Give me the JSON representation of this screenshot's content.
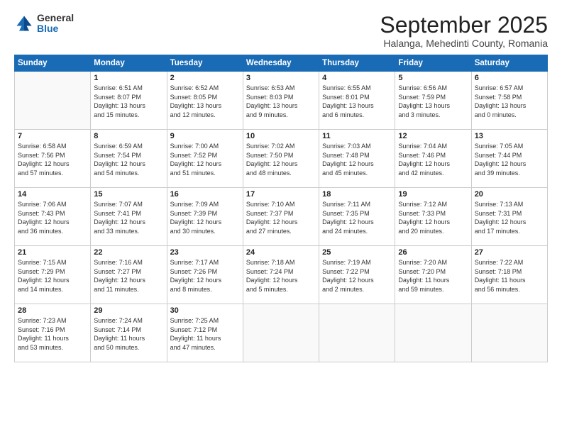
{
  "logo": {
    "general": "General",
    "blue": "Blue"
  },
  "title": "September 2025",
  "subtitle": "Halanga, Mehedinti County, Romania",
  "days_header": [
    "Sunday",
    "Monday",
    "Tuesday",
    "Wednesday",
    "Thursday",
    "Friday",
    "Saturday"
  ],
  "weeks": [
    [
      {
        "day": "",
        "info": ""
      },
      {
        "day": "1",
        "info": "Sunrise: 6:51 AM\nSunset: 8:07 PM\nDaylight: 13 hours\nand 15 minutes."
      },
      {
        "day": "2",
        "info": "Sunrise: 6:52 AM\nSunset: 8:05 PM\nDaylight: 13 hours\nand 12 minutes."
      },
      {
        "day": "3",
        "info": "Sunrise: 6:53 AM\nSunset: 8:03 PM\nDaylight: 13 hours\nand 9 minutes."
      },
      {
        "day": "4",
        "info": "Sunrise: 6:55 AM\nSunset: 8:01 PM\nDaylight: 13 hours\nand 6 minutes."
      },
      {
        "day": "5",
        "info": "Sunrise: 6:56 AM\nSunset: 7:59 PM\nDaylight: 13 hours\nand 3 minutes."
      },
      {
        "day": "6",
        "info": "Sunrise: 6:57 AM\nSunset: 7:58 PM\nDaylight: 13 hours\nand 0 minutes."
      }
    ],
    [
      {
        "day": "7",
        "info": "Sunrise: 6:58 AM\nSunset: 7:56 PM\nDaylight: 12 hours\nand 57 minutes."
      },
      {
        "day": "8",
        "info": "Sunrise: 6:59 AM\nSunset: 7:54 PM\nDaylight: 12 hours\nand 54 minutes."
      },
      {
        "day": "9",
        "info": "Sunrise: 7:00 AM\nSunset: 7:52 PM\nDaylight: 12 hours\nand 51 minutes."
      },
      {
        "day": "10",
        "info": "Sunrise: 7:02 AM\nSunset: 7:50 PM\nDaylight: 12 hours\nand 48 minutes."
      },
      {
        "day": "11",
        "info": "Sunrise: 7:03 AM\nSunset: 7:48 PM\nDaylight: 12 hours\nand 45 minutes."
      },
      {
        "day": "12",
        "info": "Sunrise: 7:04 AM\nSunset: 7:46 PM\nDaylight: 12 hours\nand 42 minutes."
      },
      {
        "day": "13",
        "info": "Sunrise: 7:05 AM\nSunset: 7:44 PM\nDaylight: 12 hours\nand 39 minutes."
      }
    ],
    [
      {
        "day": "14",
        "info": "Sunrise: 7:06 AM\nSunset: 7:43 PM\nDaylight: 12 hours\nand 36 minutes."
      },
      {
        "day": "15",
        "info": "Sunrise: 7:07 AM\nSunset: 7:41 PM\nDaylight: 12 hours\nand 33 minutes."
      },
      {
        "day": "16",
        "info": "Sunrise: 7:09 AM\nSunset: 7:39 PM\nDaylight: 12 hours\nand 30 minutes."
      },
      {
        "day": "17",
        "info": "Sunrise: 7:10 AM\nSunset: 7:37 PM\nDaylight: 12 hours\nand 27 minutes."
      },
      {
        "day": "18",
        "info": "Sunrise: 7:11 AM\nSunset: 7:35 PM\nDaylight: 12 hours\nand 24 minutes."
      },
      {
        "day": "19",
        "info": "Sunrise: 7:12 AM\nSunset: 7:33 PM\nDaylight: 12 hours\nand 20 minutes."
      },
      {
        "day": "20",
        "info": "Sunrise: 7:13 AM\nSunset: 7:31 PM\nDaylight: 12 hours\nand 17 minutes."
      }
    ],
    [
      {
        "day": "21",
        "info": "Sunrise: 7:15 AM\nSunset: 7:29 PM\nDaylight: 12 hours\nand 14 minutes."
      },
      {
        "day": "22",
        "info": "Sunrise: 7:16 AM\nSunset: 7:27 PM\nDaylight: 12 hours\nand 11 minutes."
      },
      {
        "day": "23",
        "info": "Sunrise: 7:17 AM\nSunset: 7:26 PM\nDaylight: 12 hours\nand 8 minutes."
      },
      {
        "day": "24",
        "info": "Sunrise: 7:18 AM\nSunset: 7:24 PM\nDaylight: 12 hours\nand 5 minutes."
      },
      {
        "day": "25",
        "info": "Sunrise: 7:19 AM\nSunset: 7:22 PM\nDaylight: 12 hours\nand 2 minutes."
      },
      {
        "day": "26",
        "info": "Sunrise: 7:20 AM\nSunset: 7:20 PM\nDaylight: 11 hours\nand 59 minutes."
      },
      {
        "day": "27",
        "info": "Sunrise: 7:22 AM\nSunset: 7:18 PM\nDaylight: 11 hours\nand 56 minutes."
      }
    ],
    [
      {
        "day": "28",
        "info": "Sunrise: 7:23 AM\nSunset: 7:16 PM\nDaylight: 11 hours\nand 53 minutes."
      },
      {
        "day": "29",
        "info": "Sunrise: 7:24 AM\nSunset: 7:14 PM\nDaylight: 11 hours\nand 50 minutes."
      },
      {
        "day": "30",
        "info": "Sunrise: 7:25 AM\nSunset: 7:12 PM\nDaylight: 11 hours\nand 47 minutes."
      },
      {
        "day": "",
        "info": ""
      },
      {
        "day": "",
        "info": ""
      },
      {
        "day": "",
        "info": ""
      },
      {
        "day": "",
        "info": ""
      }
    ]
  ]
}
